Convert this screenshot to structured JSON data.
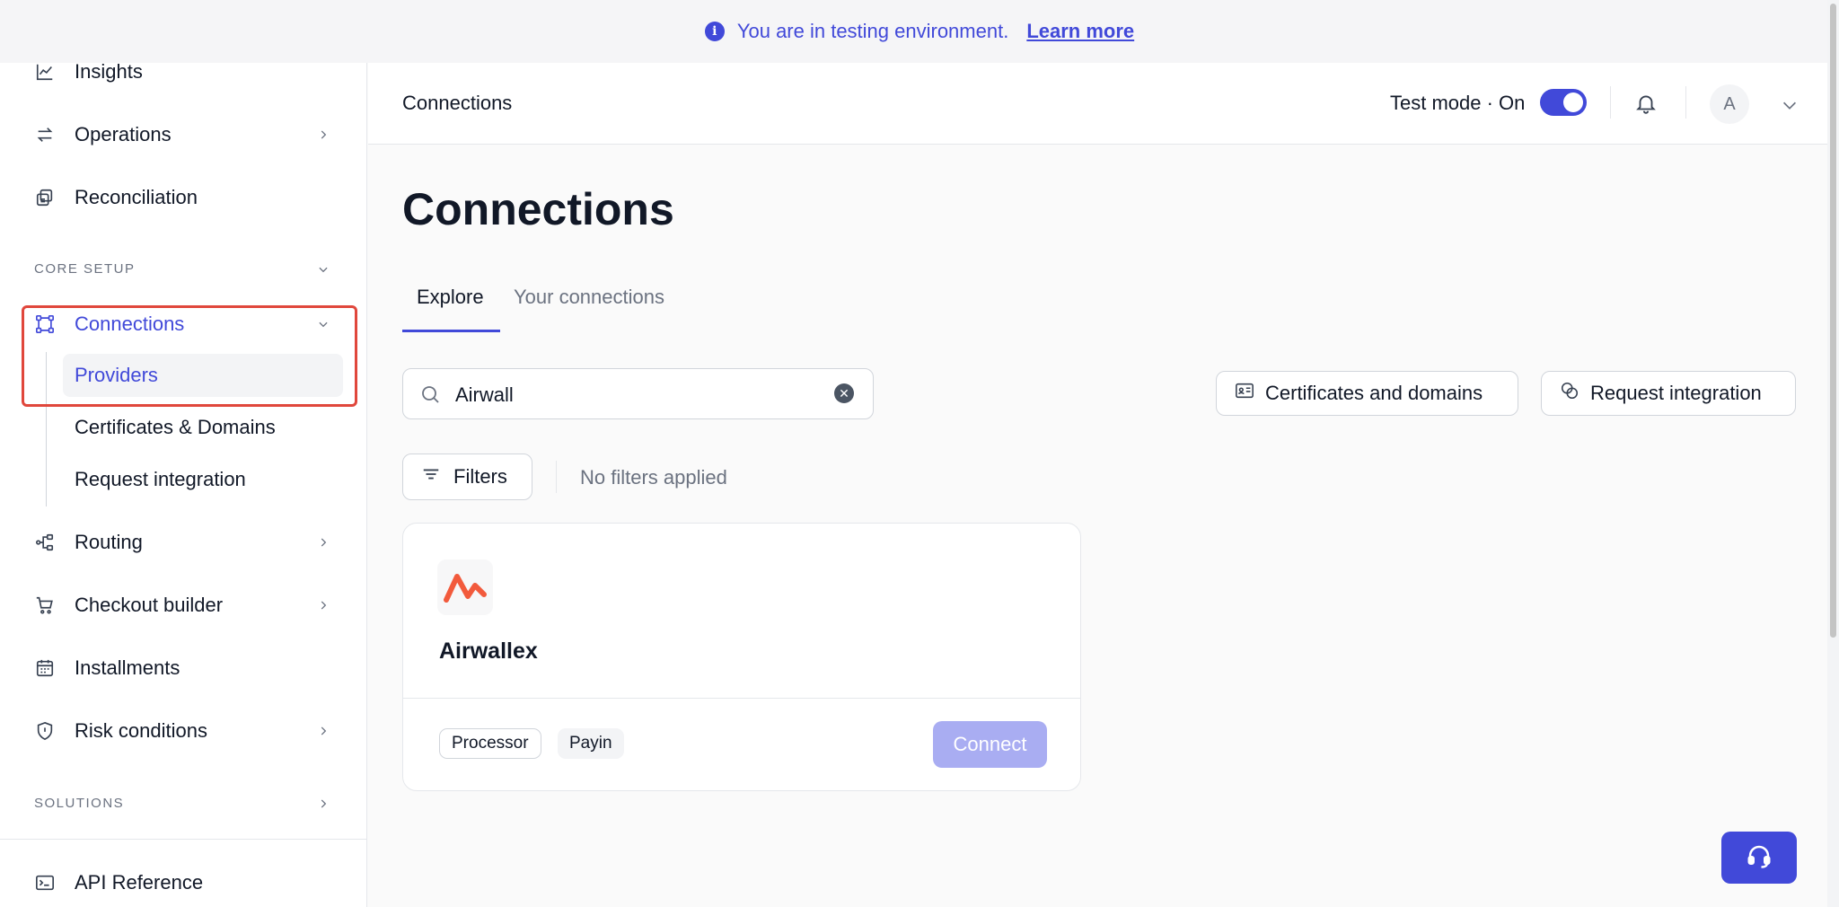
{
  "banner": {
    "message": "You are in testing environment.",
    "link": "Learn more"
  },
  "sidebar": {
    "insights": "Insights",
    "operations": "Operations",
    "reconciliation": "Reconciliation",
    "core_setup": "CORE SETUP",
    "connections": "Connections",
    "providers": "Providers",
    "certificates": "Certificates & Domains",
    "request_integration": "Request integration",
    "routing": "Routing",
    "checkout_builder": "Checkout builder",
    "installments": "Installments",
    "risk_conditions": "Risk conditions",
    "solutions": "SOLUTIONS",
    "api_reference": "API Reference"
  },
  "header": {
    "breadcrumb": "Connections",
    "test_mode": "Test mode · On",
    "avatar_initial": "A"
  },
  "main": {
    "title": "Connections",
    "tabs": [
      "Explore",
      "Your connections"
    ],
    "search_value": "Airwall",
    "cert_button": "Certificates and domains",
    "request_button": "Request integration",
    "filters_button": "Filters",
    "filters_status": "No filters applied"
  },
  "card": {
    "name": "Airwallex",
    "tags": [
      "Processor",
      "Payin"
    ],
    "connect": "Connect"
  },
  "colors": {
    "accent": "#4149d9",
    "highlight": "#e0473c",
    "connect_disabled": "#a9adf2",
    "logo": "#f25a3c"
  }
}
